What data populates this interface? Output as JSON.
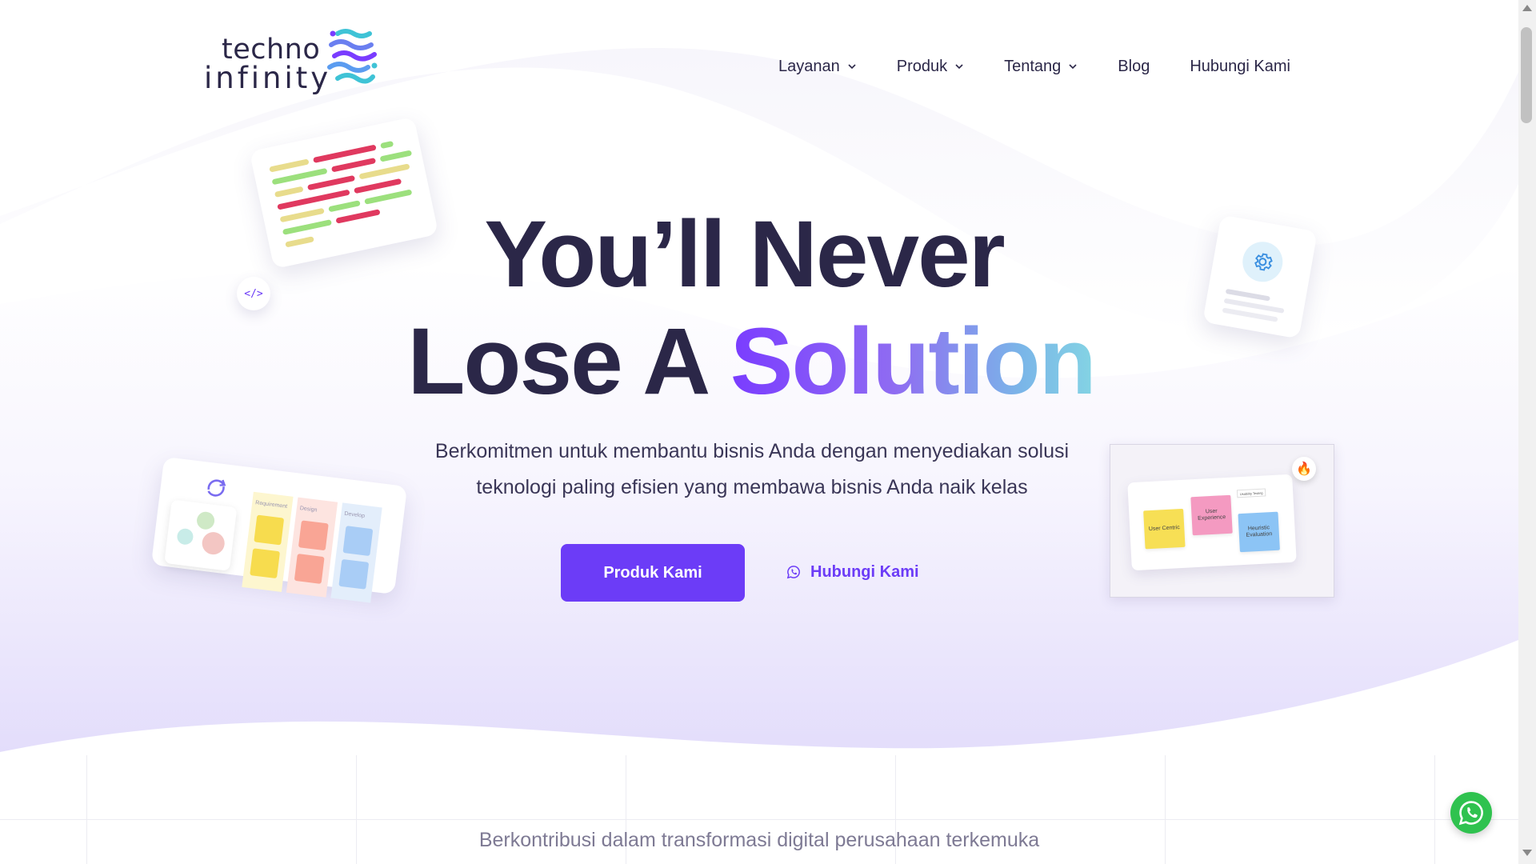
{
  "brand": {
    "line1": "techno",
    "line2": "infinity",
    "colors": [
      "#7a3cff",
      "#3fc3d6",
      "#5b9cf0"
    ]
  },
  "nav": {
    "items": [
      {
        "label": "Layanan",
        "dropdown": true
      },
      {
        "label": "Produk",
        "dropdown": true
      },
      {
        "label": "Tentang",
        "dropdown": true
      },
      {
        "label": "Blog",
        "dropdown": false
      },
      {
        "label": "Hubungi Kami",
        "dropdown": false
      }
    ]
  },
  "hero": {
    "title_line1": "You’ll Never",
    "title_line2_plain": "Lose A ",
    "title_line2_accent": "Solution",
    "subtitle_line1": "Berkomitmen untuk membantu bisnis Anda dengan menyediakan solusi",
    "subtitle_line2": "teknologi paling efisien yang membawa bisnis Anda naik kelas",
    "primary_button": "Produk Kami",
    "secondary_button": "Hubungi Kami",
    "secondary_icon": "whatsapp-icon"
  },
  "decor": {
    "code_tag": "</>",
    "kanban_columns": [
      "Requirement",
      "Design",
      "Develop"
    ],
    "ux_notes": [
      "User Centric",
      "User Experience",
      "Heuristic Evaluation"
    ],
    "ux_small_note": "Usability Testing"
  },
  "contribution": {
    "text": "Berkontribusi dalam transformasi digital perusahaan terkemuka"
  },
  "colors": {
    "accent": "#6c3cf7",
    "title": "#2b2748",
    "whatsapp": "#2fc24f"
  }
}
